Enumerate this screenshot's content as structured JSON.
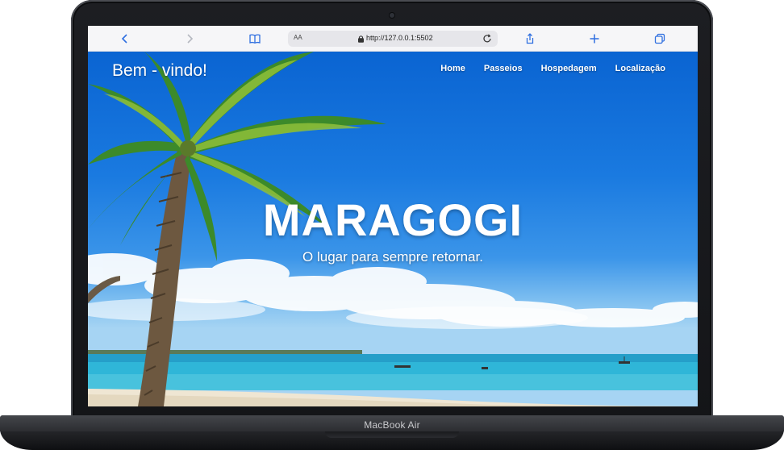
{
  "device": {
    "label": "MacBook Air"
  },
  "browser": {
    "url": "http://127.0.0.1:5502",
    "text_size_label": "AA",
    "icons": {
      "back": "chevron-left-icon",
      "forward": "chevron-right-icon",
      "bookmarks": "book-icon",
      "share": "share-icon",
      "new_tab": "plus-icon",
      "tabs": "tabs-icon",
      "reload": "reload-icon",
      "lock": "lock-icon"
    }
  },
  "site": {
    "brand": "Bem - vindo!",
    "nav": [
      "Home",
      "Passeios",
      "Hospedagem",
      "Localização"
    ],
    "hero_title": "MARAGOGI",
    "hero_subtitle": "O lugar para sempre retornar."
  },
  "colors": {
    "browser_accent": "#2f6fe0",
    "sky": "#1a7ae0",
    "sea": "#2fb6d8",
    "sand": "#efe6d3"
  }
}
